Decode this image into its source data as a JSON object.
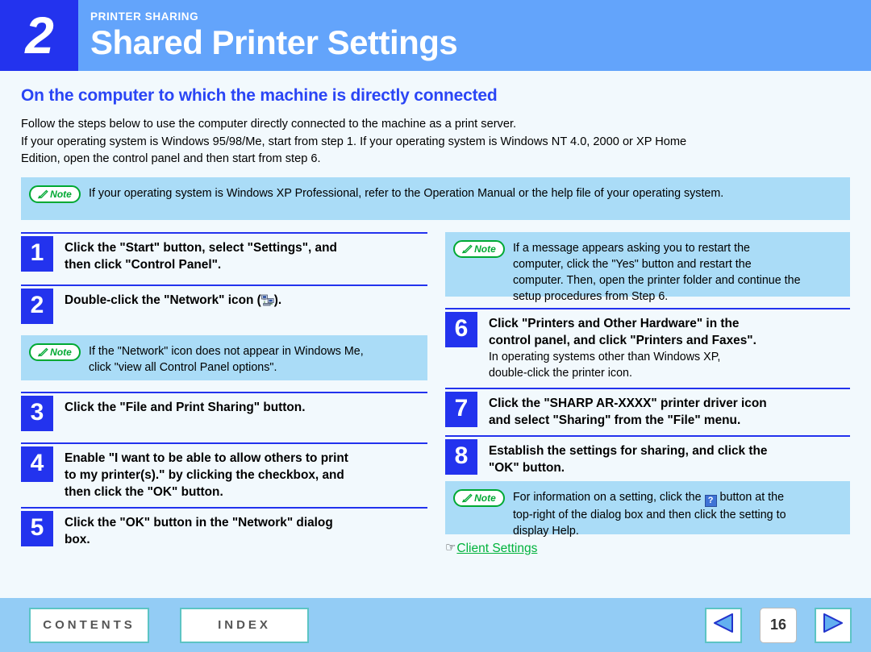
{
  "header": {
    "chapter_number": "2",
    "kicker": "PRINTER SHARING",
    "title": "Shared Printer Settings"
  },
  "section": {
    "heading": "On the computer to which the machine is directly connected",
    "intro_lines": [
      "Follow the steps below to use the computer directly connected to the machine as a print server.",
      "If your operating system is Windows 95/98/Me, start from step 1. If your operating system is Windows NT 4.0, 2000 or XP Home",
      "Edition, open the control panel and then start from step 6."
    ]
  },
  "note_badge": {
    "label": "Note",
    "icon": "pencil-icon",
    "color": "#00a933"
  },
  "top_note": {
    "text": "If your operating system is Windows XP Professional, refer to the Operation Manual or the help file of your operating system."
  },
  "left_column": {
    "step1": {
      "number": "1",
      "line1": "Click the \"Start\" button, select \"Settings\", and",
      "line2": "then click \"Control Panel\"."
    },
    "step2": {
      "number": "2",
      "text_before": "Double-click the \"Network\" icon (",
      "icon": "network-icon",
      "text_after": ")."
    },
    "note1": {
      "line1": "If the \"Network\" icon does not appear in Windows Me,",
      "line2": "click \"view all Control Panel options\"."
    },
    "step3": {
      "number": "3",
      "line1": "Click the \"File and Print Sharing\" button."
    },
    "step4": {
      "number": "4",
      "line1": "Enable \"I want to be able to allow others to print",
      "line2": "to my printer(s).\" by clicking the checkbox, and",
      "line3": "then click the \"OK\" button."
    },
    "step5": {
      "number": "5",
      "line1": "Click the \"OK\" button in the \"Network\" dialog",
      "line2": "box."
    }
  },
  "right_column": {
    "note_restart": {
      "line1": "If a message appears asking you to restart the",
      "line2": "computer, click the \"Yes\" button and restart the",
      "line3": "computer. Then, open the printer folder and continue the",
      "line4": "setup procedures from Step 6."
    },
    "step6": {
      "number": "6",
      "line1": "Click \"Printers and Other Hardware\" in the",
      "line2": "control panel, and click \"Printers and Faxes\".",
      "sub1": "In operating systems other than Windows XP,",
      "sub2": "double-click the printer icon."
    },
    "step7": {
      "number": "7",
      "line1": "Click the \"SHARP AR-XXXX\" printer driver icon",
      "line2": "and select \"Sharing\" from the \"File\" menu."
    },
    "step8": {
      "number": "8",
      "line1": "Establish the settings for sharing, and click the",
      "line2": "\"OK\" button."
    },
    "note_help": {
      "line1_before": "For information on a setting, click the",
      "help_icon_label": "?",
      "line1_after": "button at the",
      "line2": "top-right of the dialog box and then click the setting to",
      "line3": "display Help."
    },
    "link": {
      "hand": "☞",
      "label": "Client Settings"
    }
  },
  "footer": {
    "contents_label": "CONTENTS",
    "index_label": "INDEX",
    "prev_icon": "previous-page-arrow-icon",
    "next_icon": "next-page-arrow-icon",
    "page_number": "16"
  }
}
